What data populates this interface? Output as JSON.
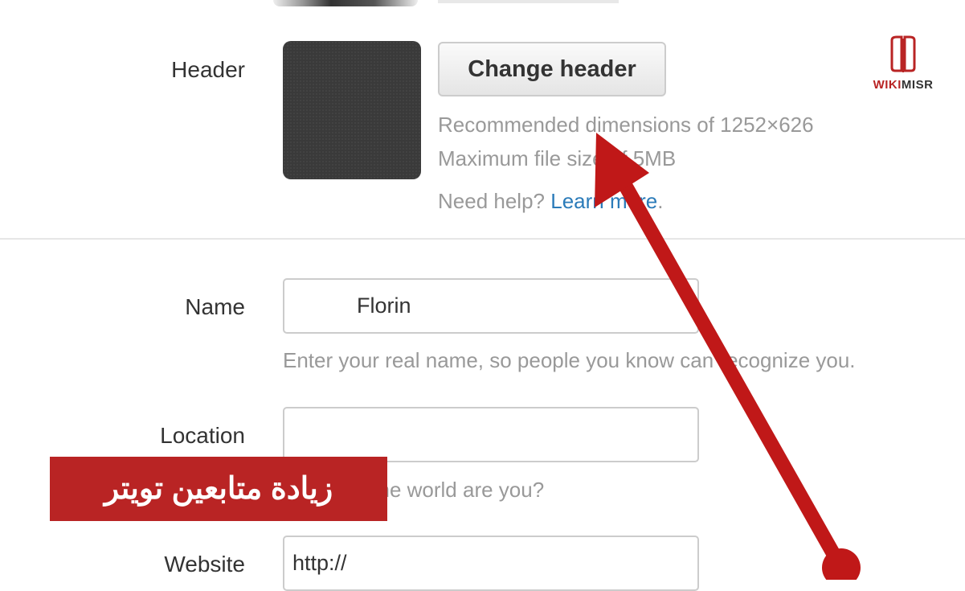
{
  "header_section": {
    "label": "Header",
    "change_button": "Change header",
    "recommended": "Recommended dimensions of 1252×626",
    "max_size": "Maximum file size of 5MB",
    "help_prefix": "Need help?",
    "help_link": "Learn more",
    "help_suffix": "."
  },
  "profile_form": {
    "name_label": "Name",
    "name_value": "Florin",
    "name_hint": "Enter your real name, so people you know can recognize you.",
    "location_label": "Location",
    "location_value": "",
    "location_hint": "Where in the world are you?",
    "website_label": "Website",
    "website_value": "http://"
  },
  "overlay": {
    "banner_text": "زيادة متابعين تويتر",
    "logo_text_red": "WIKI",
    "logo_text_dark": "MISR",
    "arrow_color": "#c01818",
    "banner_color": "#b92424"
  }
}
